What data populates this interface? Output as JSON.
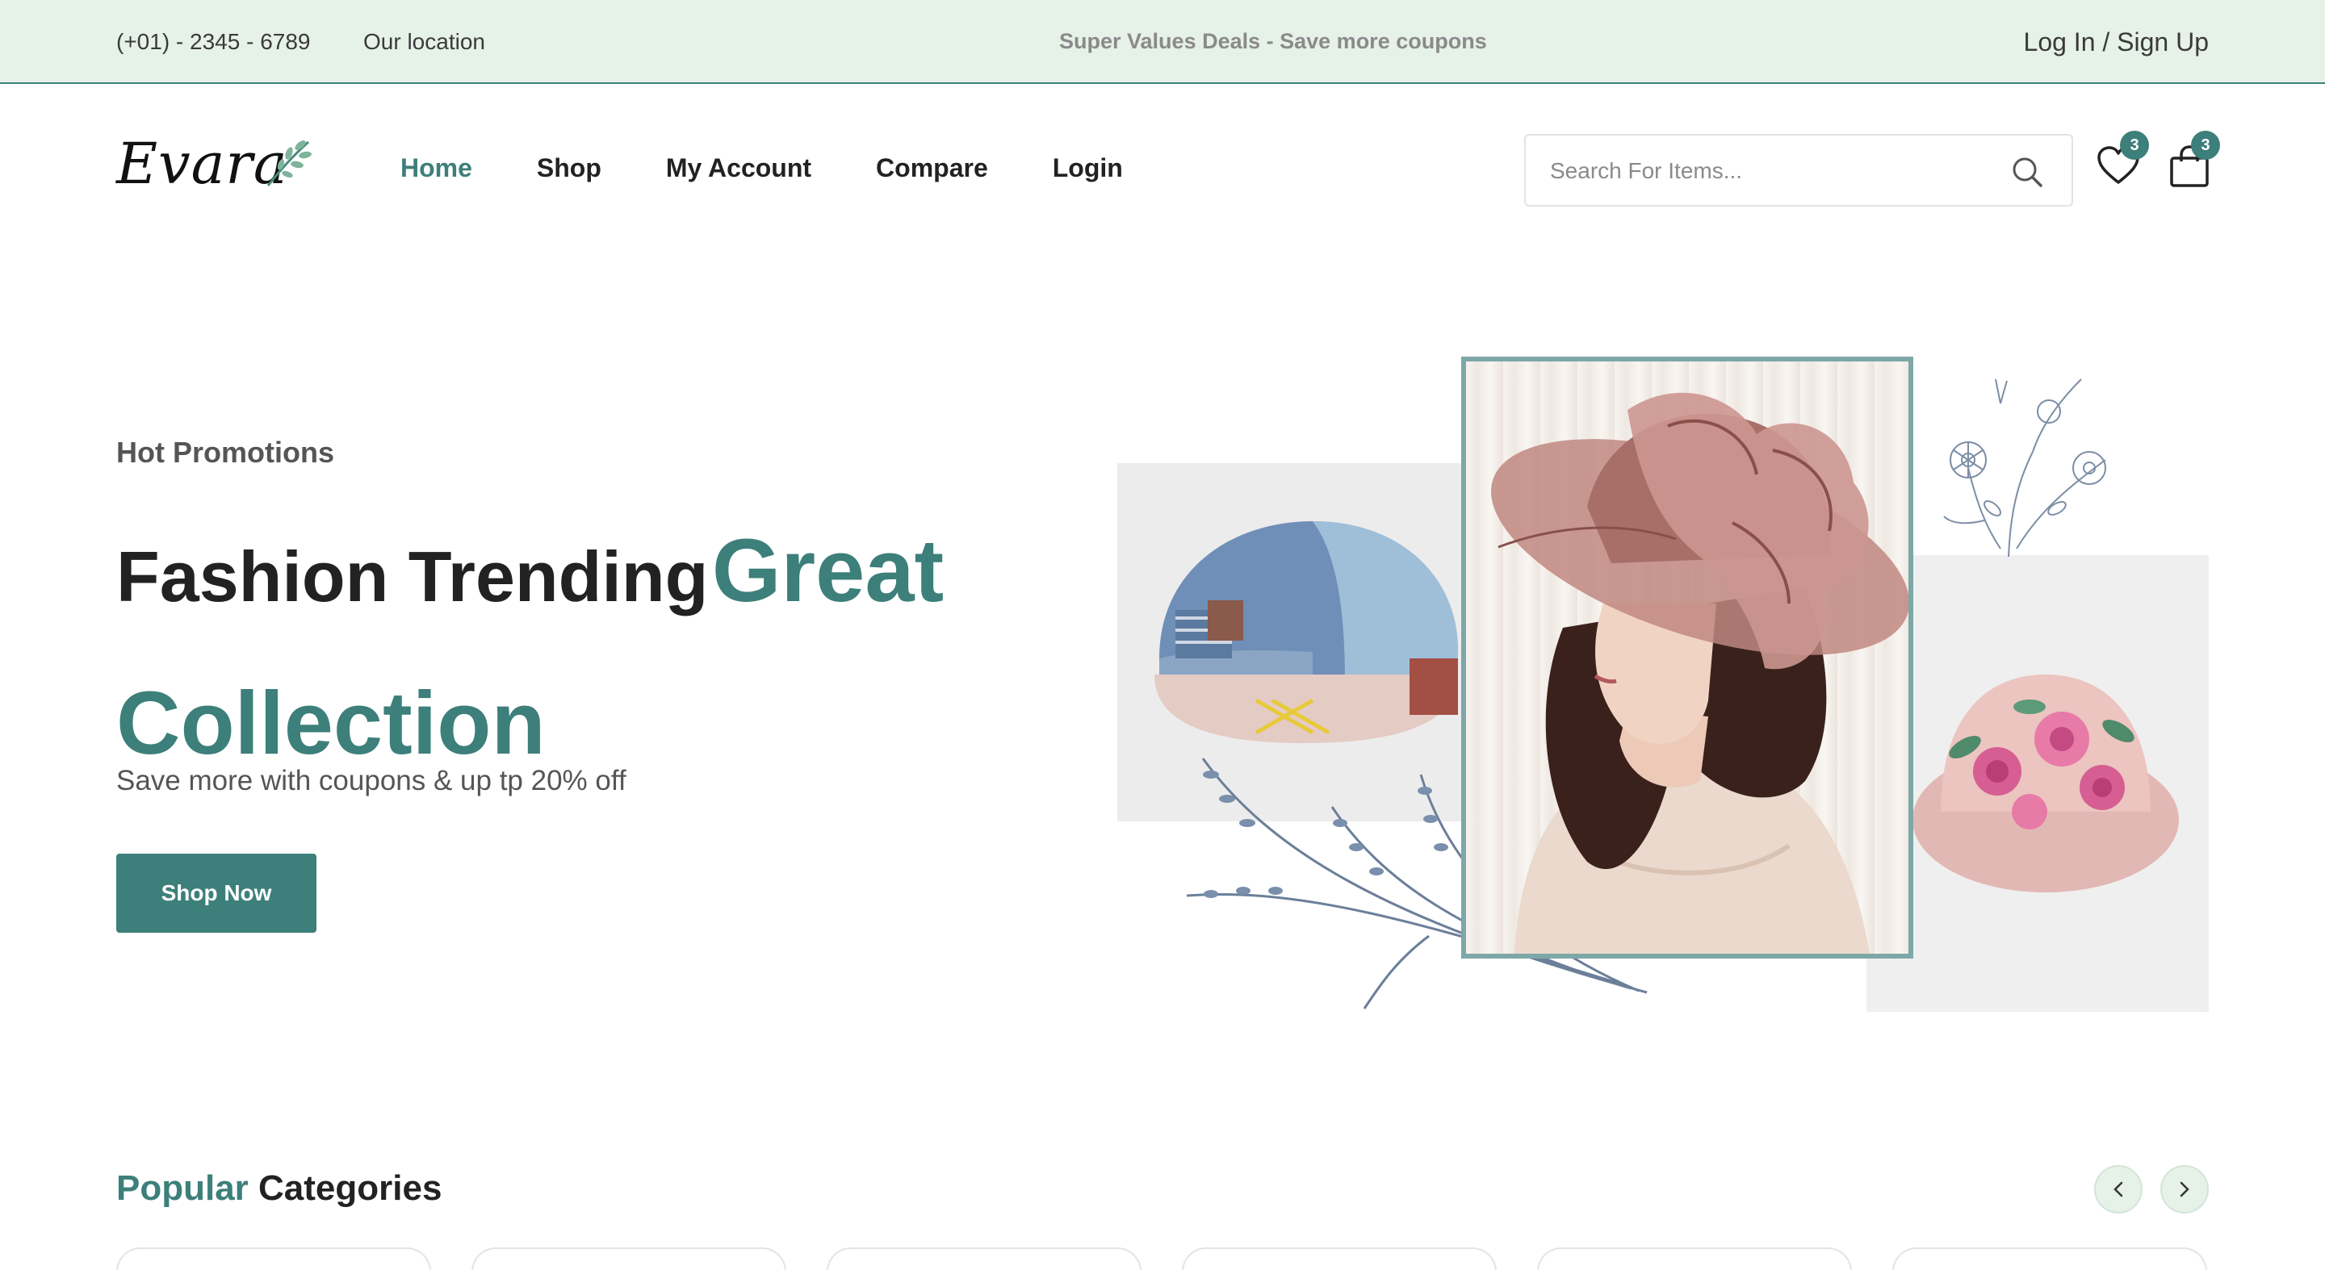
{
  "topbar": {
    "phone": "(+01) - 2345 - 6789",
    "location": "Our location",
    "deals": "Super Values Deals - Save more coupons",
    "login": "Log In / Sign Up"
  },
  "header": {
    "logo_text": "Evara",
    "nav": [
      "Home",
      "Shop",
      "My Account",
      "Compare",
      "Login"
    ],
    "active_nav": "Home",
    "search_placeholder": "Search For Items...",
    "wishlist_count": "3",
    "cart_count": "3"
  },
  "hero": {
    "eyebrow": "Hot Promotions",
    "title_dark": "Fashion Trending",
    "title_accent_1": "Great",
    "title_accent_2": "Collection",
    "subtitle": "Save more with coupons & up tp 20% off",
    "button": "Shop Now"
  },
  "categories": {
    "title_accent": "Popular",
    "title_dark": "Categories"
  },
  "colors": {
    "accent": "#3d7f7a",
    "topbar_bg": "#e6f1e8"
  },
  "icons": [
    "search-icon",
    "heart-icon",
    "shopping-bag-icon",
    "chevron-left-icon",
    "chevron-right-icon"
  ]
}
